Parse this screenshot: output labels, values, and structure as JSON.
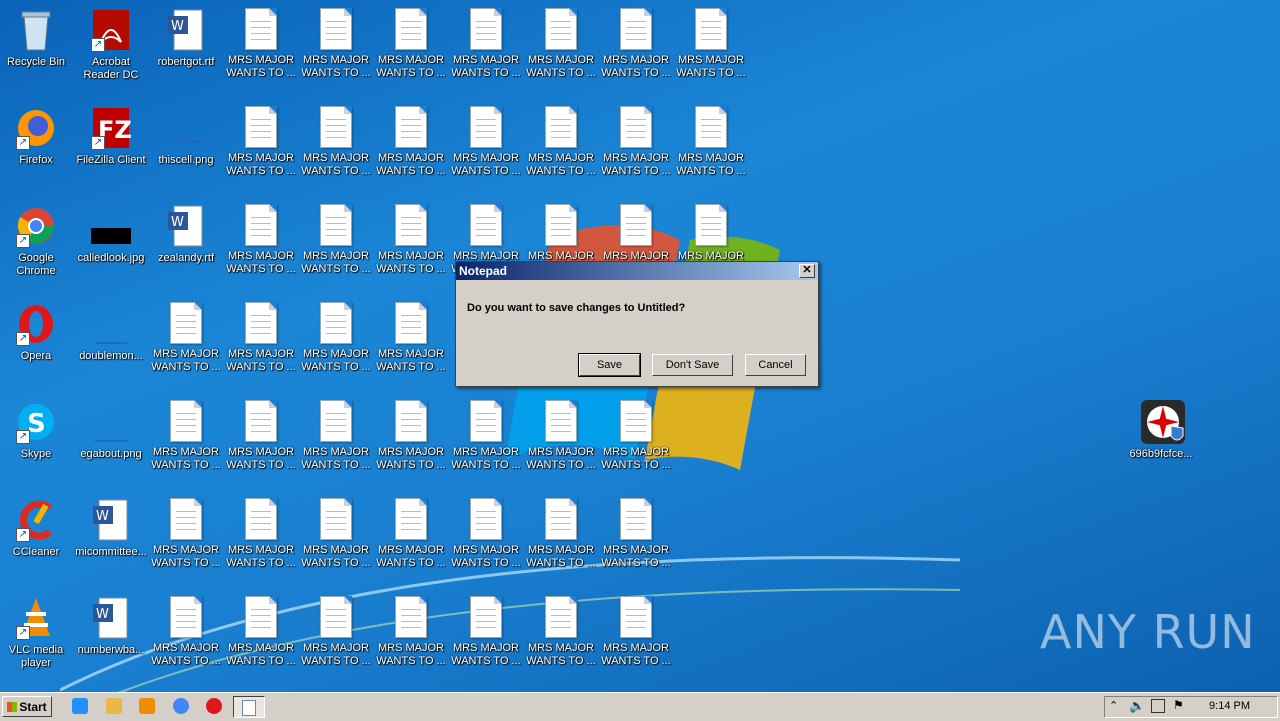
{
  "desktop": {
    "left_column": [
      {
        "label": "Recycle Bin",
        "icon": "recycle-bin-icon"
      },
      {
        "label": "Acrobat Reader DC",
        "icon": "acrobat-icon"
      },
      {
        "label": "robertgot.rtf",
        "icon": "word-doc-icon"
      },
      {
        "label": "Firefox",
        "icon": "firefox-icon"
      },
      {
        "label": "FileZilla Client",
        "icon": "filezilla-icon"
      },
      {
        "label": "thiscell.png",
        "icon": "image-file-icon"
      },
      {
        "label": "Google Chrome",
        "icon": "chrome-icon"
      },
      {
        "label": "calledlook.jpg",
        "icon": "image-file-icon"
      },
      {
        "label": "zealandy.rtf",
        "icon": "word-doc-icon"
      },
      {
        "label": "Opera",
        "icon": "opera-icon"
      },
      {
        "label": "doublemon...",
        "icon": "image-file-icon"
      },
      {
        "label": "Skype",
        "icon": "skype-icon"
      },
      {
        "label": "egabout.png",
        "icon": "image-file-icon"
      },
      {
        "label": "CCleaner",
        "icon": "ccleaner-icon"
      },
      {
        "label": "micommittee...",
        "icon": "word-doc-icon"
      },
      {
        "label": "VLC media player",
        "icon": "vlc-icon"
      },
      {
        "label": "numberwba...",
        "icon": "word-doc-icon"
      }
    ],
    "mrs_label": "MRS MAJOR WANTS TO ...",
    "right_icon": {
      "label": "696b9fcfce...",
      "icon": "umbrella-shield-icon"
    }
  },
  "dialog": {
    "title": "Notepad",
    "message": "Do you want to save changes to Untitled?",
    "save": "Save",
    "dont_save": "Don't Save",
    "cancel": "Cancel"
  },
  "taskbar": {
    "start": "Start",
    "clock": "9:14 PM"
  },
  "watermark": "ANY RUN"
}
